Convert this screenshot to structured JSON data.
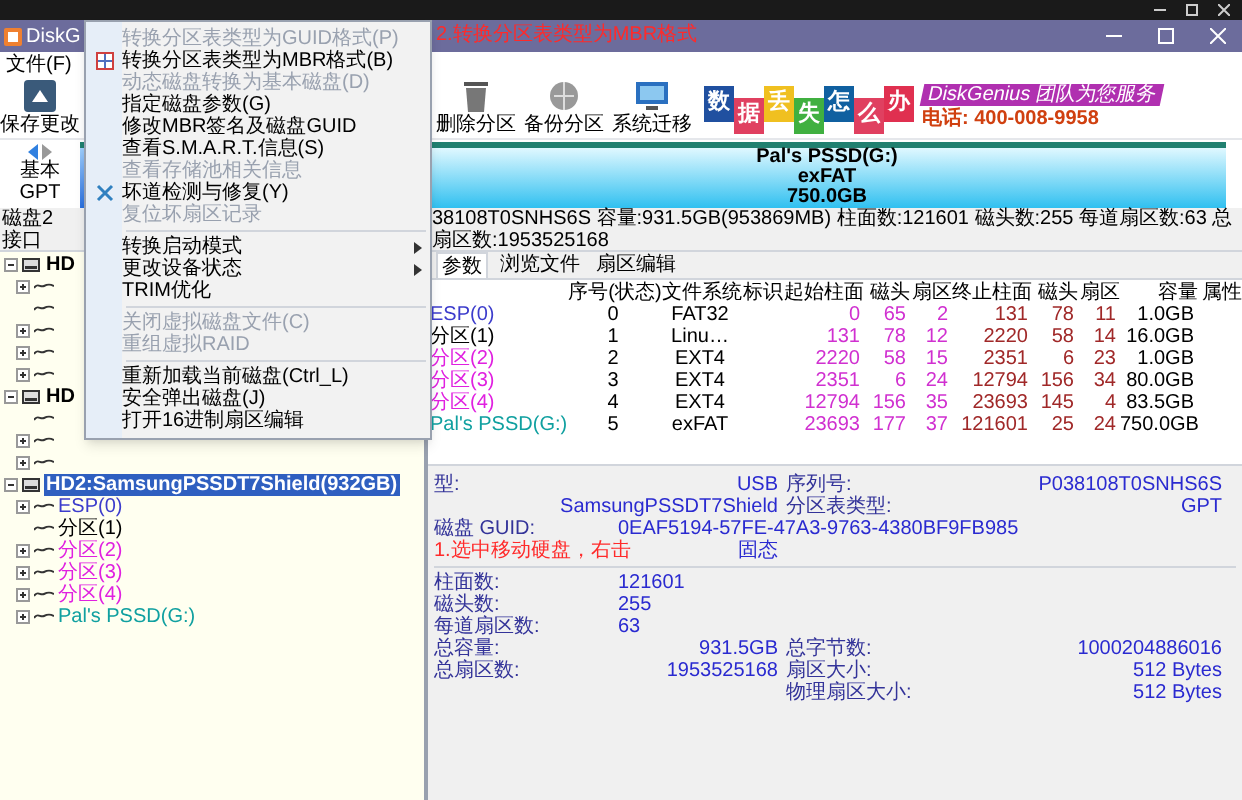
{
  "window": {
    "title": "DiskG"
  },
  "annotations": [
    {
      "kind": "title",
      "text": "2.转换分区表类型为MBR格式"
    },
    {
      "kind": "details",
      "text": "1.选中移动硬盘，右击"
    }
  ],
  "menu_bar": [
    "文件(F)"
  ],
  "toolbar": [
    {
      "label": "保存更改"
    },
    {
      "label": "删除分区"
    },
    {
      "label": "备份分区"
    },
    {
      "label": "系统迁移"
    }
  ],
  "banner": {
    "tiles": [
      "数",
      "据",
      "丢",
      "失",
      "怎",
      "么",
      "办"
    ],
    "slogan": "DiskGenius 团队为您服务",
    "phone": "电话: 400-008-9958"
  },
  "disk_bar": {
    "type": "基本",
    "scheme": "GPT",
    "partition": {
      "name": "Pal's PSSD(G:)",
      "file_system": "exFAT",
      "size": "750.0GB"
    }
  },
  "info_line": [
    "磁盘2 接口",
    "38108T0SNHS6S 容量:931.5GB(953869MB) 柱面数:121601 磁头数:255 每道扇区数:63 总扇区数:1953525168"
  ],
  "tree": [
    {
      "label": "HD",
      "selected": false,
      "expanded": true,
      "children": [
        {
          "expandable": true
        },
        {
          "expandable": false
        },
        {
          "expandable": true
        },
        {
          "expandable": true
        },
        {
          "expandable": true
        }
      ]
    },
    {
      "label": "HD",
      "selected": false,
      "expanded": true,
      "children": [
        {
          "expandable": false
        },
        {
          "expandable": true
        },
        {
          "expandable": true
        }
      ]
    },
    {
      "label": "HD2:SamsungPSSDT7Shield(932GB)",
      "selected": true,
      "expanded": true,
      "children": [
        {
          "label": "ESP(0)",
          "color": "#3c3ccc",
          "expandable": true
        },
        {
          "label": "分区(1)",
          "color": "#000000",
          "expandable": false
        },
        {
          "label": "分区(2)",
          "color": "#e020e0",
          "expandable": true
        },
        {
          "label": "分区(3)",
          "color": "#e020e0",
          "expandable": true
        },
        {
          "label": "分区(4)",
          "color": "#e020e0",
          "expandable": true
        },
        {
          "label": "Pal's PSSD(G:)",
          "color": "#10a0a0",
          "expandable": true
        }
      ]
    }
  ],
  "tabs": [
    {
      "label": "参数",
      "selected": true
    },
    {
      "label": "浏览文件",
      "selected": false
    },
    {
      "label": "扇区编辑",
      "selected": false
    }
  ],
  "table": {
    "columns": [
      "序号(状态)",
      "文件系统",
      "标识",
      "起始柱面",
      "磁头",
      "扇区",
      "终止柱面",
      "磁头",
      "扇区",
      "容量",
      "属性"
    ],
    "rows": [
      {
        "name": "ESP(0)",
        "color": "#3c3ccc",
        "cells": [
          "0",
          "FAT32",
          "",
          "0",
          "65",
          "2",
          "131",
          "78",
          "11",
          "1.0GB",
          ""
        ]
      },
      {
        "name": "分区(1)",
        "color": "#000000",
        "cells": [
          "1",
          "Linu…",
          "",
          "131",
          "78",
          "12",
          "2220",
          "58",
          "14",
          "16.0GB",
          ""
        ]
      },
      {
        "name": "分区(2)",
        "color": "#e020e0",
        "cells": [
          "2",
          "EXT4",
          "",
          "2220",
          "58",
          "15",
          "2351",
          "6",
          "23",
          "1.0GB",
          ""
        ]
      },
      {
        "name": "分区(3)",
        "color": "#e020e0",
        "cells": [
          "3",
          "EXT4",
          "",
          "2351",
          "6",
          "24",
          "12794",
          "156",
          "34",
          "80.0GB",
          ""
        ]
      },
      {
        "name": "分区(4)",
        "color": "#e020e0",
        "cells": [
          "4",
          "EXT4",
          "",
          "12794",
          "156",
          "35",
          "23693",
          "145",
          "4",
          "83.5GB",
          ""
        ]
      },
      {
        "name": "Pal's PSSD(G:)",
        "color": "#10a0a0",
        "cells": [
          "5",
          "exFAT",
          "",
          "23693",
          "177",
          "37",
          "121601",
          "25",
          "24",
          "750.0GB",
          ""
        ]
      }
    ]
  },
  "details": {
    "sections": [
      [
        {
          "label": "型:",
          "value": "USB",
          "label_2": "序列号:",
          "value_2": "P038108T0SNHS6S"
        },
        {
          "value": "SamsungPSSDT7Shield",
          "label_2": "分区表类型:",
          "value_2": "GPT"
        },
        {
          "label": "磁盘 GUID:",
          "value": "0EAF5194-57FE-47A3-9763-4380BF9FB985"
        },
        {
          "value": "固态"
        }
      ],
      [
        {
          "label": "柱面数:",
          "value": "121601"
        },
        {
          "label": "磁头数:",
          "value": "255"
        },
        {
          "label": "每道扇区数:",
          "value": "63"
        },
        {
          "label": "总容量:",
          "value": "931.5GB",
          "label_2": "总字节数:",
          "value_2": "1000204886016"
        },
        {
          "label": "总扇区数:",
          "value": "1953525168",
          "label_2": "扇区大小:",
          "value_2": "512 Bytes"
        },
        {
          "label_2": "物理扇区大小:",
          "value_2": "512 Bytes"
        }
      ]
    ]
  },
  "context_menu": {
    "items": [
      {
        "kind": "command",
        "label": "转换分区表类型为GUID格式(P)",
        "disabled": true
      },
      {
        "kind": "command",
        "label": "转换分区表类型为MBR格式(B)",
        "disabled": false
      },
      {
        "kind": "command",
        "label": "动态磁盘转换为基本磁盘(D)",
        "disabled": true
      },
      {
        "kind": "command",
        "label": "指定磁盘参数(G)",
        "disabled": false
      },
      {
        "kind": "command",
        "label": "修改MBR签名及磁盘GUID",
        "disabled": false
      },
      {
        "kind": "command",
        "label": "查看S.M.A.R.T.信息(S)",
        "disabled": false
      },
      {
        "kind": "command",
        "label": "查看存储池相关信息",
        "disabled": true
      },
      {
        "kind": "command",
        "label": "坏道检测与修复(Y)",
        "disabled": false
      },
      {
        "kind": "command",
        "label": "复位坏扇区记录",
        "disabled": true
      },
      {
        "kind": "separator"
      },
      {
        "kind": "submenu",
        "label": "转换启动模式",
        "disabled": false
      },
      {
        "kind": "submenu",
        "label": "更改设备状态",
        "disabled": false
      },
      {
        "kind": "command",
        "label": "TRIM优化",
        "disabled": false
      },
      {
        "kind": "separator"
      },
      {
        "kind": "command",
        "label": "关闭虚拟磁盘文件(C)",
        "disabled": true
      },
      {
        "kind": "command",
        "label": "重组虚拟RAID",
        "disabled": true
      },
      {
        "kind": "separator"
      },
      {
        "kind": "command",
        "label": "重新加载当前磁盘(Ctrl_L)",
        "disabled": false
      },
      {
        "kind": "command",
        "label": "安全弹出磁盘(J)",
        "disabled": false
      },
      {
        "kind": "command",
        "label": "打开16进制扇区编辑",
        "disabled": false
      }
    ]
  }
}
